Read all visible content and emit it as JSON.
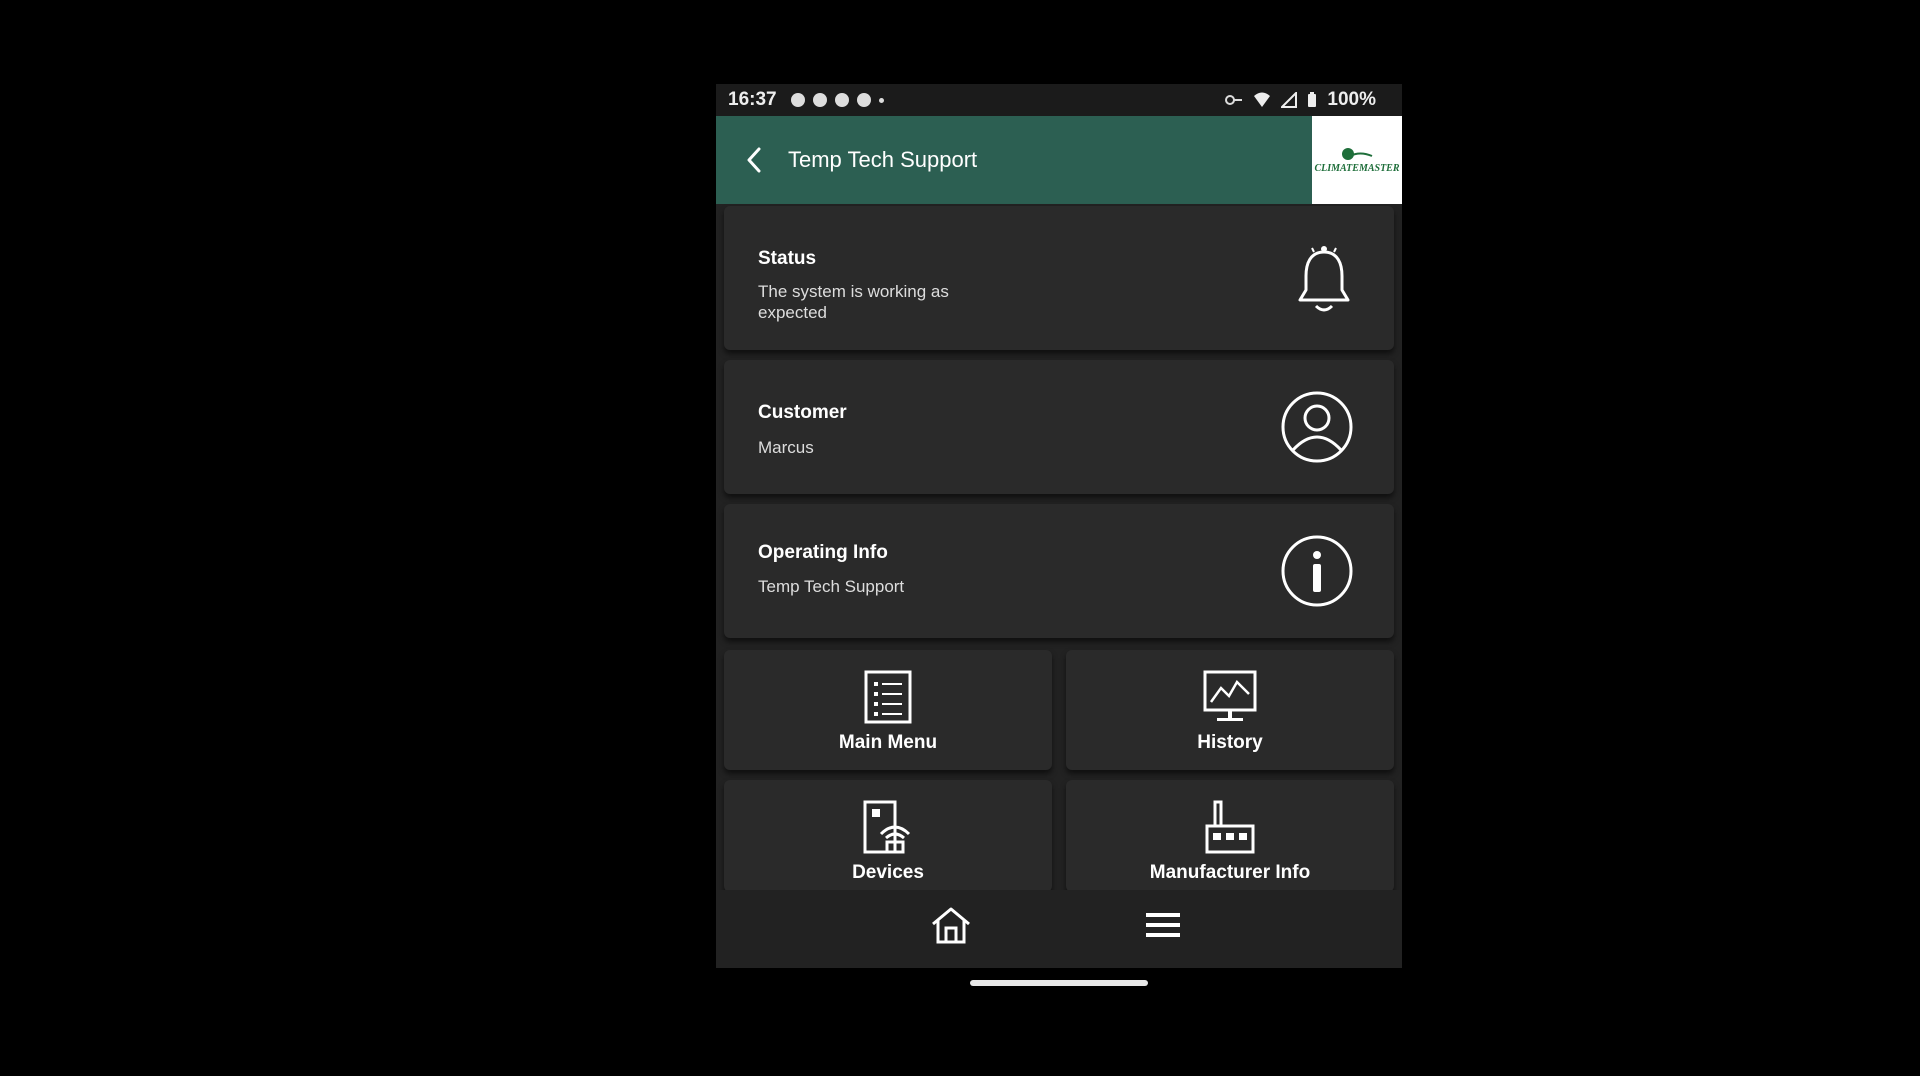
{
  "status_bar": {
    "time": "16:37",
    "battery": "100%"
  },
  "app_bar": {
    "title": "Temp Tech Support",
    "back_icon": "chevron-left-icon",
    "logo_text": "CLIMATEMASTER"
  },
  "cards": [
    {
      "title": "Status",
      "subtitle": "The system is working as expected",
      "icon": "bell-icon"
    },
    {
      "title": "Customer",
      "subtitle": "Marcus",
      "icon": "user-circle-icon"
    },
    {
      "title": "Operating Info",
      "subtitle": "Temp Tech Support",
      "icon": "info-circle-icon"
    }
  ],
  "tiles": [
    {
      "label": "Main Menu",
      "icon": "list-document-icon"
    },
    {
      "label": "History",
      "icon": "chart-monitor-icon"
    },
    {
      "label": "Devices",
      "icon": "device-wifi-icon"
    },
    {
      "label": "Manufacturer Info",
      "icon": "factory-icon"
    }
  ],
  "bottom_nav": {
    "home_icon": "home-icon",
    "menu_icon": "hamburger-menu-icon"
  },
  "colors": {
    "app_bar": "#2c5f52",
    "background": "#222222",
    "card": "#2a2a2a"
  }
}
